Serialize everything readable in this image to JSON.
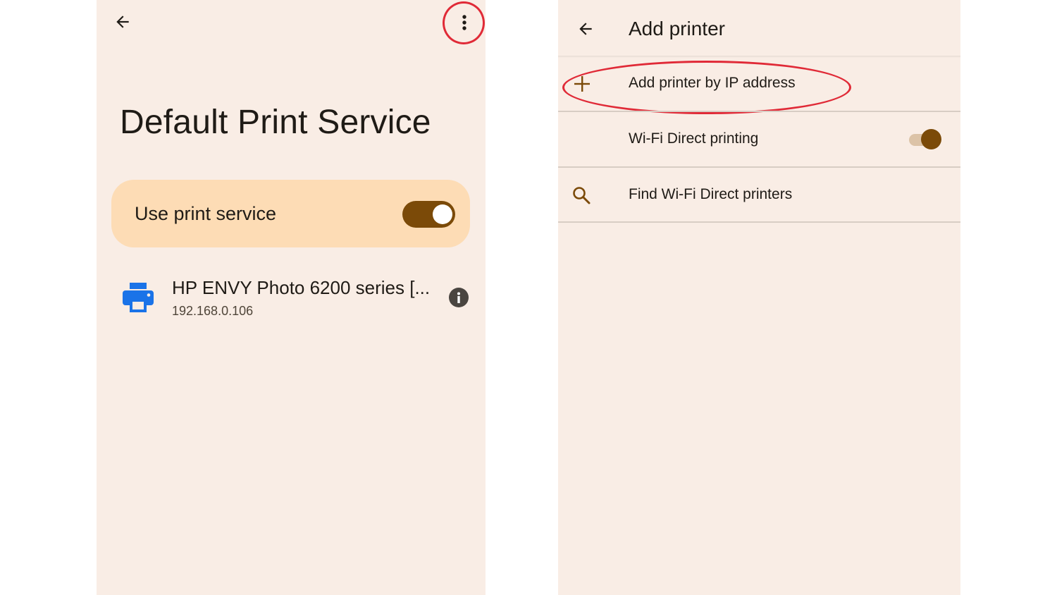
{
  "colors": {
    "panel_bg": "#f9ede5",
    "card_bg": "#fddcb5",
    "accent_brown": "#7b4a08",
    "highlight_red": "#e02a37",
    "printer_blue": "#1a73e8"
  },
  "left_screen": {
    "back_icon": "arrow-left-icon",
    "more_icon": "more-vert-icon",
    "title": "Default Print Service",
    "use_service": {
      "label": "Use print service",
      "enabled": true
    },
    "printers": [
      {
        "name": "HP ENVY Photo 6200 series [...",
        "address": "192.168.0.106",
        "icon": "printer-icon",
        "info_icon": "info-icon"
      }
    ]
  },
  "right_screen": {
    "back_icon": "arrow-left-icon",
    "title": "Add printer",
    "menu": [
      {
        "label": "Add printer by IP address",
        "icon": "plus-icon"
      },
      {
        "label": "Wi-Fi Direct printing",
        "toggle_on": true
      },
      {
        "label": "Find Wi-Fi Direct printers",
        "icon": "search-icon"
      }
    ]
  }
}
